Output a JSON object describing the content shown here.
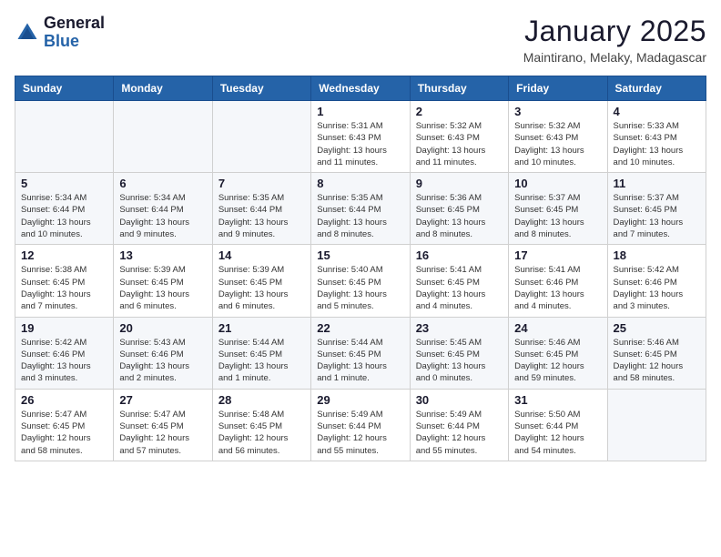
{
  "header": {
    "logo_general": "General",
    "logo_blue": "Blue",
    "month_title": "January 2025",
    "location": "Maintirano, Melaky, Madagascar"
  },
  "days_of_week": [
    "Sunday",
    "Monday",
    "Tuesday",
    "Wednesday",
    "Thursday",
    "Friday",
    "Saturday"
  ],
  "weeks": [
    [
      {
        "day": "",
        "info": ""
      },
      {
        "day": "",
        "info": ""
      },
      {
        "day": "",
        "info": ""
      },
      {
        "day": "1",
        "info": "Sunrise: 5:31 AM\nSunset: 6:43 PM\nDaylight: 13 hours\nand 11 minutes."
      },
      {
        "day": "2",
        "info": "Sunrise: 5:32 AM\nSunset: 6:43 PM\nDaylight: 13 hours\nand 11 minutes."
      },
      {
        "day": "3",
        "info": "Sunrise: 5:32 AM\nSunset: 6:43 PM\nDaylight: 13 hours\nand 10 minutes."
      },
      {
        "day": "4",
        "info": "Sunrise: 5:33 AM\nSunset: 6:43 PM\nDaylight: 13 hours\nand 10 minutes."
      }
    ],
    [
      {
        "day": "5",
        "info": "Sunrise: 5:34 AM\nSunset: 6:44 PM\nDaylight: 13 hours\nand 10 minutes."
      },
      {
        "day": "6",
        "info": "Sunrise: 5:34 AM\nSunset: 6:44 PM\nDaylight: 13 hours\nand 9 minutes."
      },
      {
        "day": "7",
        "info": "Sunrise: 5:35 AM\nSunset: 6:44 PM\nDaylight: 13 hours\nand 9 minutes."
      },
      {
        "day": "8",
        "info": "Sunrise: 5:35 AM\nSunset: 6:44 PM\nDaylight: 13 hours\nand 8 minutes."
      },
      {
        "day": "9",
        "info": "Sunrise: 5:36 AM\nSunset: 6:45 PM\nDaylight: 13 hours\nand 8 minutes."
      },
      {
        "day": "10",
        "info": "Sunrise: 5:37 AM\nSunset: 6:45 PM\nDaylight: 13 hours\nand 8 minutes."
      },
      {
        "day": "11",
        "info": "Sunrise: 5:37 AM\nSunset: 6:45 PM\nDaylight: 13 hours\nand 7 minutes."
      }
    ],
    [
      {
        "day": "12",
        "info": "Sunrise: 5:38 AM\nSunset: 6:45 PM\nDaylight: 13 hours\nand 7 minutes."
      },
      {
        "day": "13",
        "info": "Sunrise: 5:39 AM\nSunset: 6:45 PM\nDaylight: 13 hours\nand 6 minutes."
      },
      {
        "day": "14",
        "info": "Sunrise: 5:39 AM\nSunset: 6:45 PM\nDaylight: 13 hours\nand 6 minutes."
      },
      {
        "day": "15",
        "info": "Sunrise: 5:40 AM\nSunset: 6:45 PM\nDaylight: 13 hours\nand 5 minutes."
      },
      {
        "day": "16",
        "info": "Sunrise: 5:41 AM\nSunset: 6:45 PM\nDaylight: 13 hours\nand 4 minutes."
      },
      {
        "day": "17",
        "info": "Sunrise: 5:41 AM\nSunset: 6:46 PM\nDaylight: 13 hours\nand 4 minutes."
      },
      {
        "day": "18",
        "info": "Sunrise: 5:42 AM\nSunset: 6:46 PM\nDaylight: 13 hours\nand 3 minutes."
      }
    ],
    [
      {
        "day": "19",
        "info": "Sunrise: 5:42 AM\nSunset: 6:46 PM\nDaylight: 13 hours\nand 3 minutes."
      },
      {
        "day": "20",
        "info": "Sunrise: 5:43 AM\nSunset: 6:46 PM\nDaylight: 13 hours\nand 2 minutes."
      },
      {
        "day": "21",
        "info": "Sunrise: 5:44 AM\nSunset: 6:45 PM\nDaylight: 13 hours\nand 1 minute."
      },
      {
        "day": "22",
        "info": "Sunrise: 5:44 AM\nSunset: 6:45 PM\nDaylight: 13 hours\nand 1 minute."
      },
      {
        "day": "23",
        "info": "Sunrise: 5:45 AM\nSunset: 6:45 PM\nDaylight: 13 hours\nand 0 minutes."
      },
      {
        "day": "24",
        "info": "Sunrise: 5:46 AM\nSunset: 6:45 PM\nDaylight: 12 hours\nand 59 minutes."
      },
      {
        "day": "25",
        "info": "Sunrise: 5:46 AM\nSunset: 6:45 PM\nDaylight: 12 hours\nand 58 minutes."
      }
    ],
    [
      {
        "day": "26",
        "info": "Sunrise: 5:47 AM\nSunset: 6:45 PM\nDaylight: 12 hours\nand 58 minutes."
      },
      {
        "day": "27",
        "info": "Sunrise: 5:47 AM\nSunset: 6:45 PM\nDaylight: 12 hours\nand 57 minutes."
      },
      {
        "day": "28",
        "info": "Sunrise: 5:48 AM\nSunset: 6:45 PM\nDaylight: 12 hours\nand 56 minutes."
      },
      {
        "day": "29",
        "info": "Sunrise: 5:49 AM\nSunset: 6:44 PM\nDaylight: 12 hours\nand 55 minutes."
      },
      {
        "day": "30",
        "info": "Sunrise: 5:49 AM\nSunset: 6:44 PM\nDaylight: 12 hours\nand 55 minutes."
      },
      {
        "day": "31",
        "info": "Sunrise: 5:50 AM\nSunset: 6:44 PM\nDaylight: 12 hours\nand 54 minutes."
      },
      {
        "day": "",
        "info": ""
      }
    ]
  ]
}
